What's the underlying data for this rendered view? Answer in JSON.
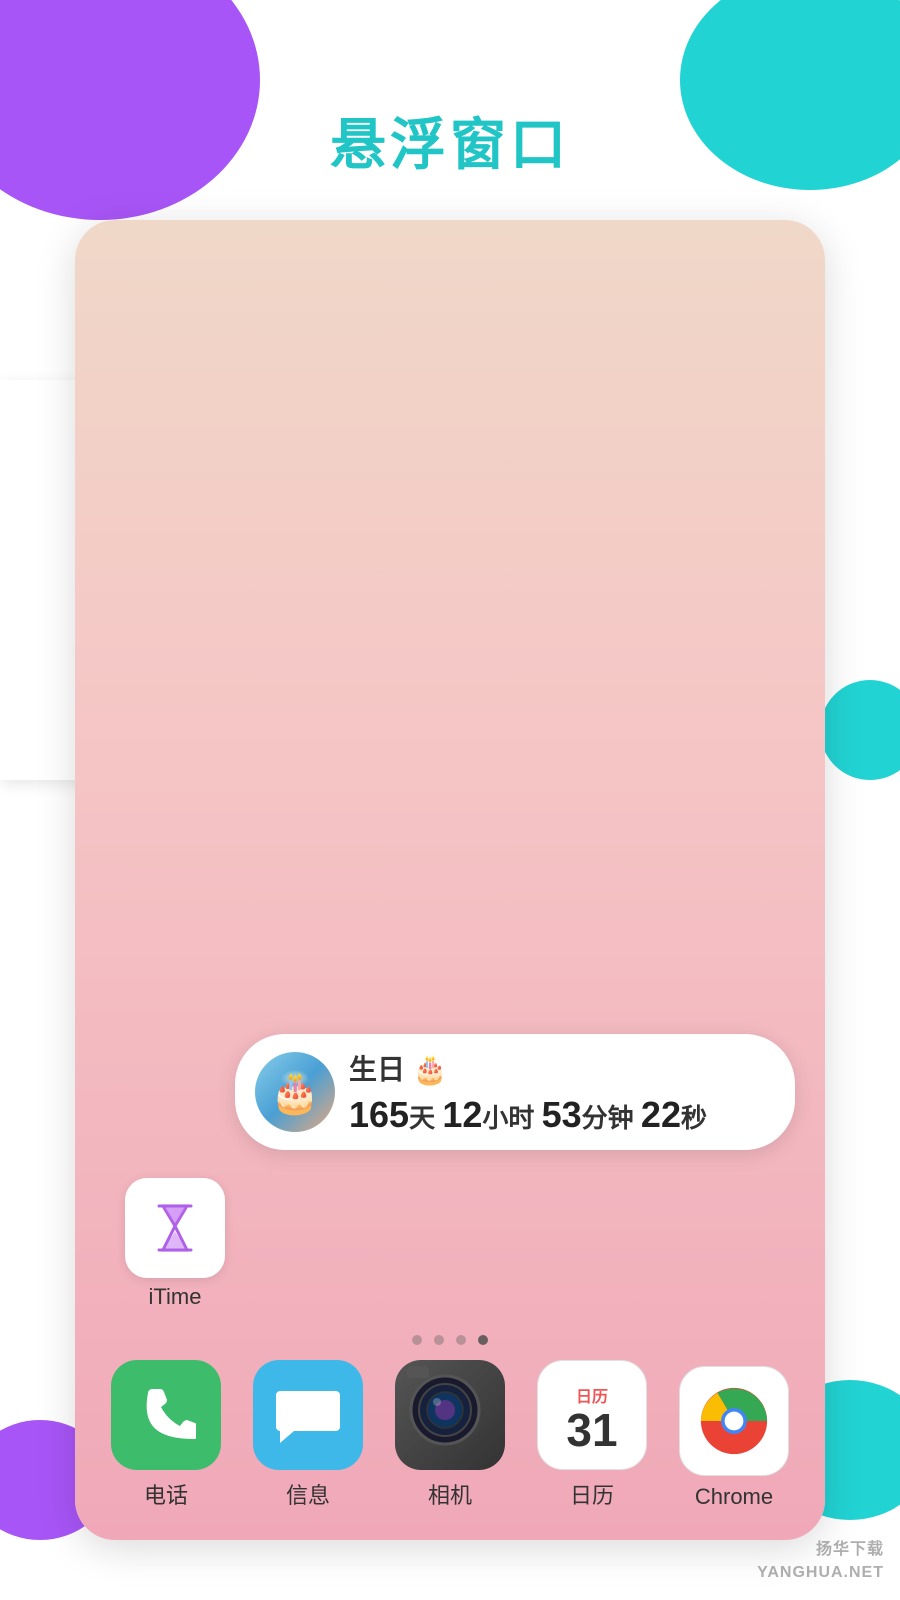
{
  "page": {
    "title": "悬浮窗口",
    "background": {
      "purple": "#a855f7",
      "teal": "#22d3d3"
    }
  },
  "widget": {
    "title": "生日 🎂",
    "countdown": {
      "days": "165",
      "days_label": "天",
      "hours": "12",
      "hours_label": "小时",
      "minutes": "53",
      "minutes_label": "分钟",
      "seconds": "22",
      "seconds_label": "秒"
    }
  },
  "itime_app": {
    "label": "iTime"
  },
  "dock_apps": [
    {
      "id": "phone",
      "label": "电话",
      "type": "phone"
    },
    {
      "id": "message",
      "label": "信息",
      "type": "message"
    },
    {
      "id": "camera",
      "label": "相机",
      "type": "camera"
    },
    {
      "id": "calendar",
      "label": "日历",
      "type": "calendar",
      "month": "",
      "day": "31"
    },
    {
      "id": "chrome",
      "label": "Chrome",
      "type": "chrome"
    }
  ],
  "watermark": "扬华下载\nYANGHUA.NET"
}
